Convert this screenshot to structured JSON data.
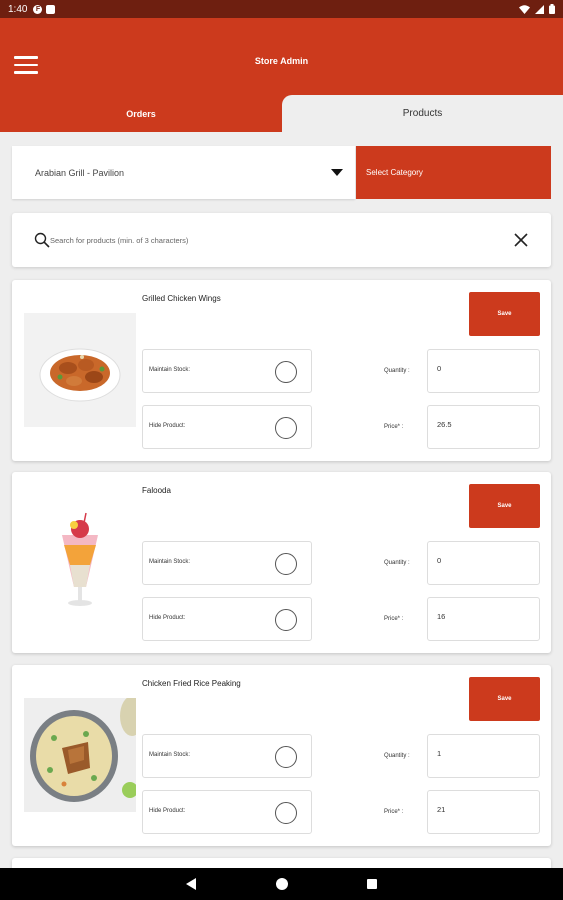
{
  "status_bar": {
    "time": "1:40"
  },
  "app": {
    "title": "Store Admin"
  },
  "tabs": [
    {
      "label": "Orders"
    },
    {
      "label": "Products"
    }
  ],
  "store_select": {
    "value": "Arabian Grill - Pavilion"
  },
  "category_button": {
    "label": "Select Category"
  },
  "search": {
    "placeholder": "Search for products (min. of 3 characters)"
  },
  "labels": {
    "save": "Save",
    "maintain_stock": "Maintain Stock:",
    "hide_product": "Hide Product:",
    "quantity": "Quantity :",
    "price": "Price* :"
  },
  "products": [
    {
      "name": "Grilled Chicken Wings",
      "quantity": "0",
      "price": "26.5"
    },
    {
      "name": "Falooda",
      "quantity": "0",
      "price": "16"
    },
    {
      "name": "Chicken Fried Rice Peaking",
      "quantity": "1",
      "price": "21"
    }
  ],
  "colors": {
    "primary": "#cc3a1d",
    "status_bar": "#6e1f10",
    "background": "#eeeeee"
  }
}
